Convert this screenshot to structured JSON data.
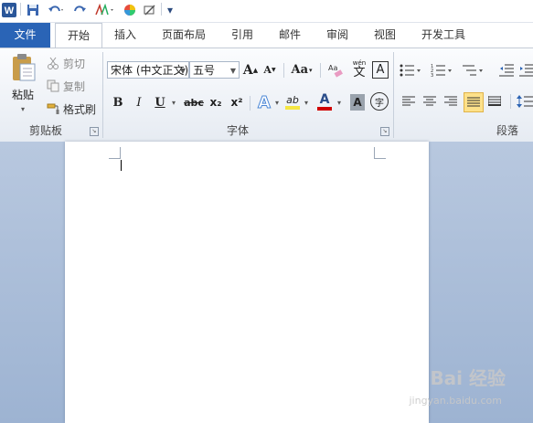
{
  "quick_access": {
    "word_icon": "W",
    "save_icon": "save-icon",
    "undo_icon": "undo-icon",
    "redo_icon": "redo-icon",
    "customize_glyph": "▾"
  },
  "tabs": [
    {
      "label": "文件"
    },
    {
      "label": "开始"
    },
    {
      "label": "插入"
    },
    {
      "label": "页面布局"
    },
    {
      "label": "引用"
    },
    {
      "label": "邮件"
    },
    {
      "label": "审阅"
    },
    {
      "label": "视图"
    },
    {
      "label": "开发工具"
    }
  ],
  "clipboard": {
    "paste_label": "粘贴",
    "cut_label": "剪切",
    "copy_label": "复制",
    "format_painter_label": "格式刷",
    "group_label": "剪贴板"
  },
  "font": {
    "font_name": "宋体 (中文正文)",
    "font_size": "五号",
    "group_label": "字体",
    "bold": "B",
    "italic": "I",
    "underline": "U",
    "strike": "abc",
    "subscript": "x₂",
    "superscript": "x²",
    "grow": "A",
    "shrink": "A",
    "change_case": "Aa",
    "phonetic": "wén",
    "phonetic_char": "文",
    "border_char": "A",
    "shading_char": "A",
    "enclose_char": "字",
    "highlight": "ab",
    "color": "A"
  },
  "paragraph": {
    "group_label": "段落"
  },
  "watermark": {
    "text": "Bai 经验",
    "url": "jingyan.baidu.com"
  },
  "colors": {
    "file_tab": "#2a64b6",
    "accent": "#2b4a7e",
    "font_color": "#d00000",
    "highlight": "#f5e642"
  }
}
